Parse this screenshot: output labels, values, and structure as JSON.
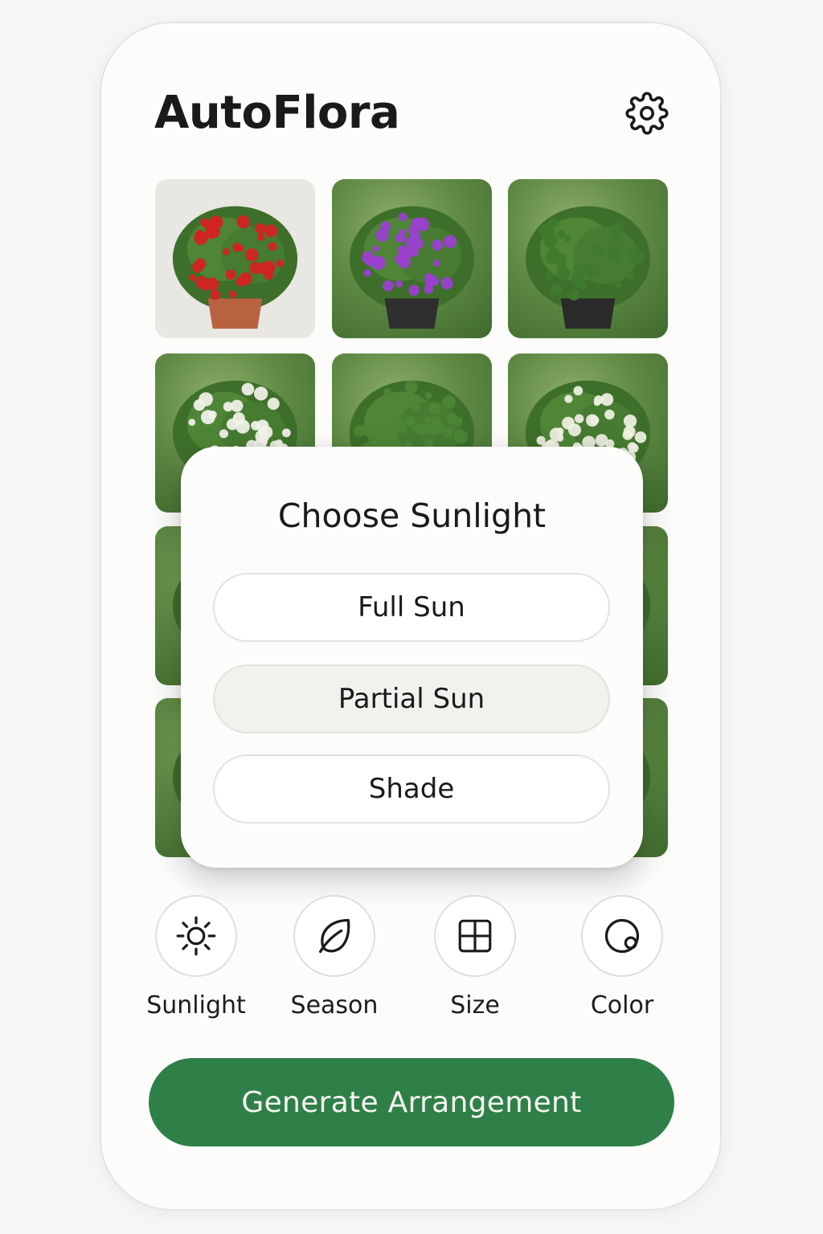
{
  "app": {
    "title": "AutoFlora"
  },
  "plants": [
    {
      "name": "red-geranium-photo",
      "background": "#e9e7e2",
      "flower": "#d42222",
      "pot": "#b8623f"
    },
    {
      "name": "purple-petunia-photo",
      "background": "#6f9a52",
      "flower": "#9b3fd0",
      "pot": "#2f2f30"
    },
    {
      "name": "green-basil-photo",
      "background": "#5f8b45",
      "flower": "#3f7a2e",
      "pot": "#2a2a2a"
    },
    {
      "name": "white-alyssum-photo",
      "background": "#5f8b45",
      "flower": "#f3f3ec",
      "pot": ""
    },
    {
      "name": "green-shrub-photo",
      "background": "#5f8b45",
      "flower": "#4c8636",
      "pot": ""
    },
    {
      "name": "white-flowering-shrub-photo",
      "background": "#5f8b45",
      "flower": "#f1f1e4",
      "pot": ""
    },
    {
      "name": "green-foliage-photo",
      "background": "#5f8b45",
      "flower": "#3f7a2e",
      "pot": ""
    },
    {
      "name": "hidden-plant-photo",
      "background": "#5f8b45",
      "flower": "#3f7a2e",
      "pot": ""
    },
    {
      "name": "lavender-plant-photo",
      "background": "#5f8b45",
      "flower": "#a98ed8",
      "pot": ""
    },
    {
      "name": "purple-flower-plant-photo",
      "background": "#5f8b45",
      "flower": "#9b83d0",
      "pot": ""
    },
    {
      "name": "hidden-plant-photo-2",
      "background": "#5f8b45",
      "flower": "#3f7a2e",
      "pot": ""
    },
    {
      "name": "yellow-flower-plant-photo",
      "background": "#5f8b45",
      "flower": "#d8cf3c",
      "pot": ""
    }
  ],
  "dialog": {
    "title": "Choose Sunlight",
    "options": [
      {
        "label": "Full Sun",
        "selected": false
      },
      {
        "label": "Partial Sun",
        "selected": true
      },
      {
        "label": "Shade",
        "selected": false
      }
    ]
  },
  "filters": [
    {
      "label": "Sunlight",
      "icon": "sun-icon"
    },
    {
      "label": "Season",
      "icon": "leaf-icon"
    },
    {
      "label": "Size",
      "icon": "grid-icon"
    },
    {
      "label": "Color",
      "icon": "color-icon"
    }
  ],
  "actions": {
    "generate_label": "Generate Arrangement"
  },
  "colors": {
    "accent": "#2f8048",
    "text": "#1a1a1a",
    "surface": "#fcfcfb"
  },
  "icons": {
    "settings": "gear-icon"
  }
}
